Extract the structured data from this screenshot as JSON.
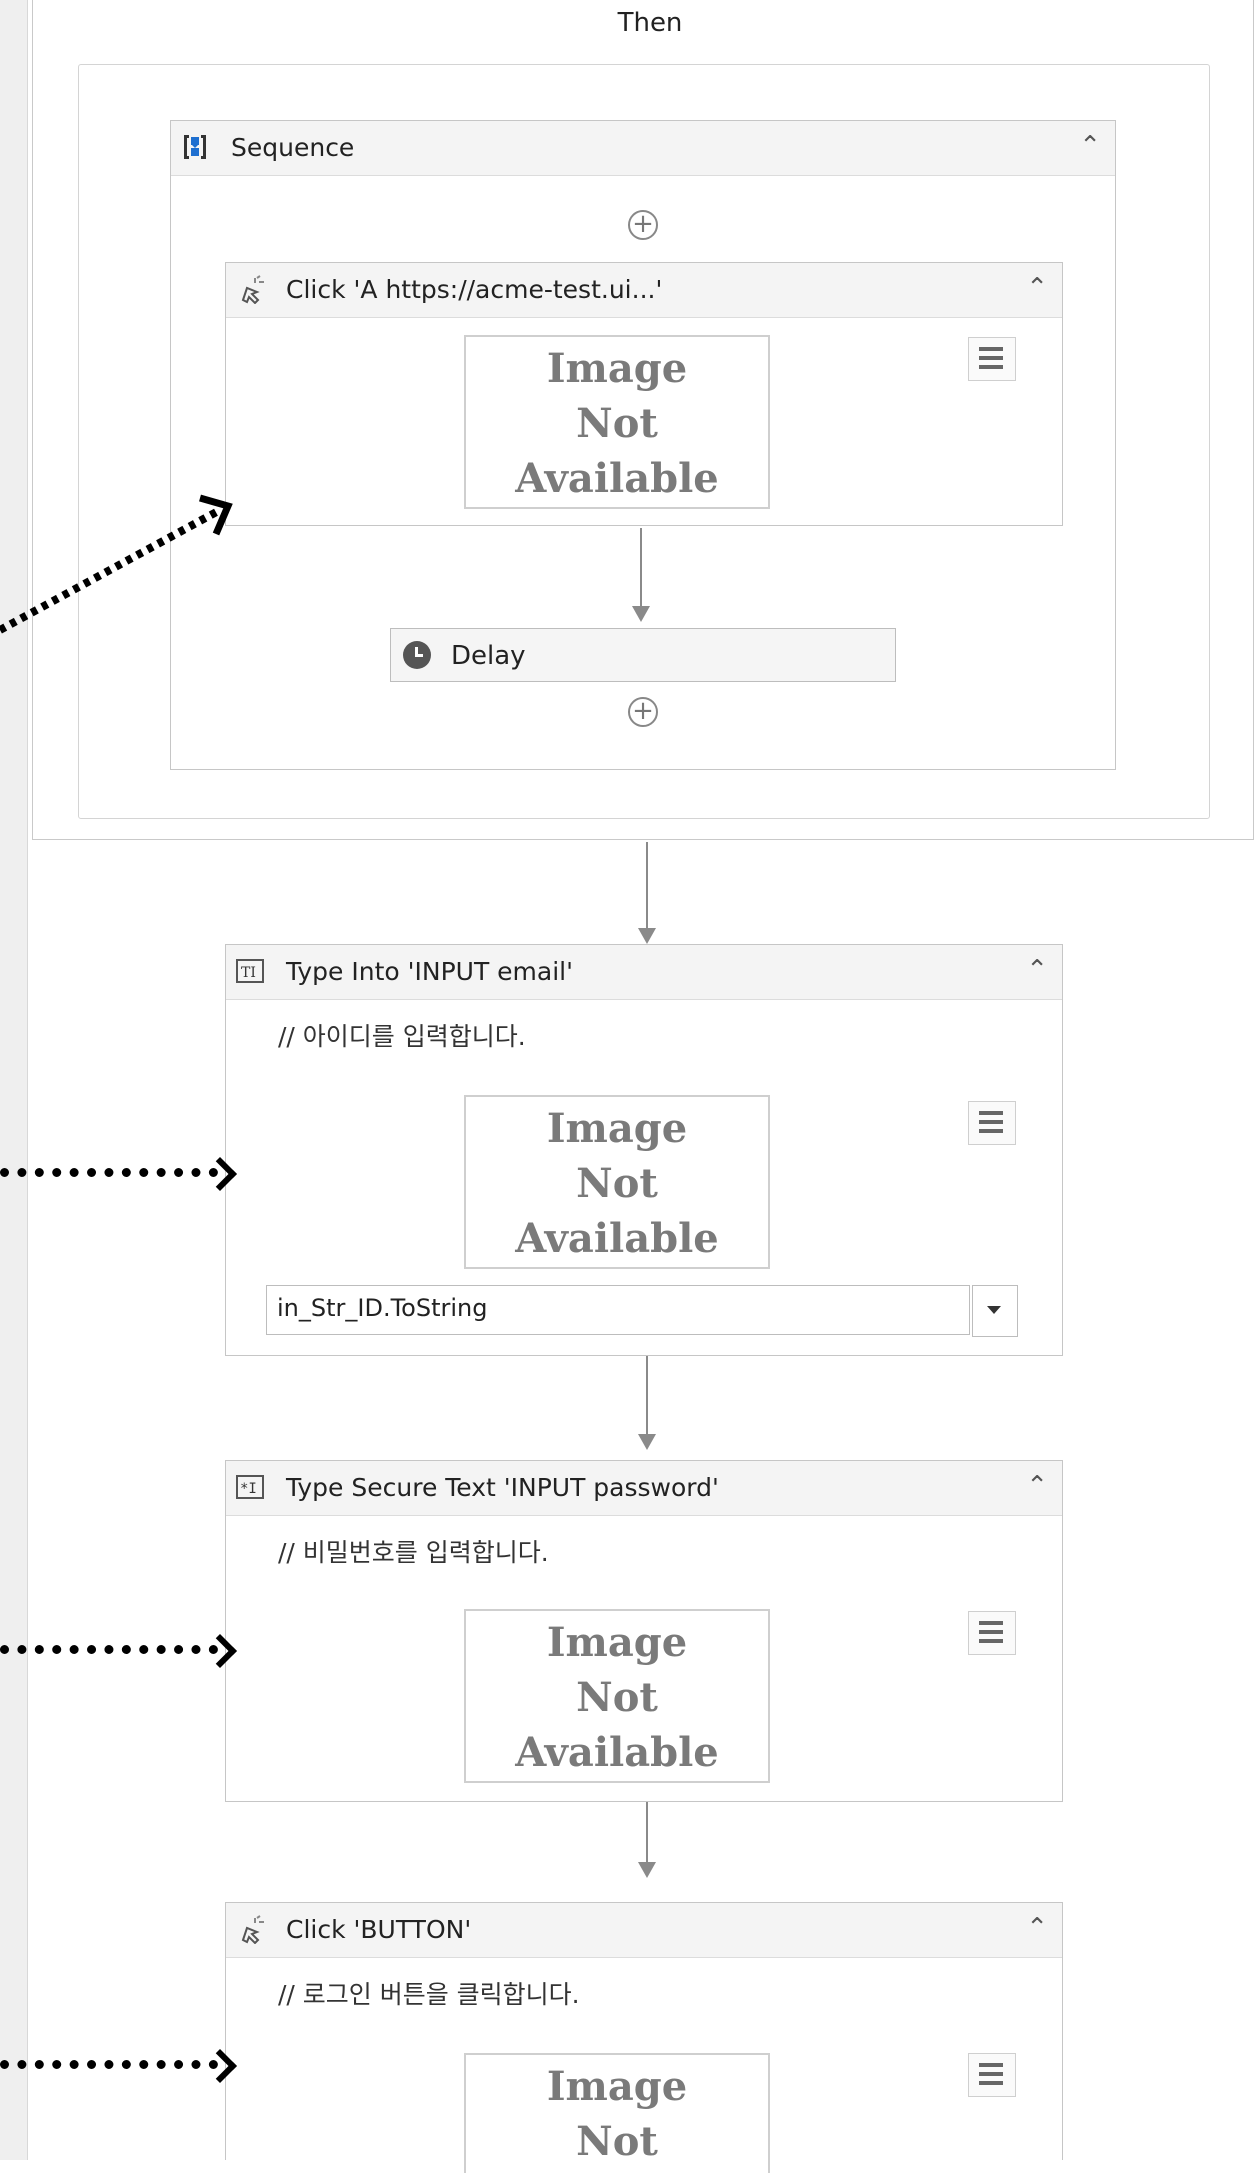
{
  "then_label": "Then",
  "sequence": {
    "title": "Sequence",
    "click_activity": {
      "title": "Click 'A  https://acme-test.ui...'",
      "image_text": [
        "Image",
        "Not",
        "Available"
      ]
    },
    "delay": {
      "label": "Delay"
    }
  },
  "type_into": {
    "title": "Type Into 'INPUT  email'",
    "comment": "// 아이디를 입력합니다.",
    "image_text": [
      "Image",
      "Not",
      "Available"
    ],
    "input_value": "in_Str_ID.ToString"
  },
  "type_secure": {
    "title": "Type Secure Text 'INPUT  password'",
    "comment": "// 비밀번호를 입력합니다.",
    "image_text": [
      "Image",
      "Not",
      "Available"
    ]
  },
  "click_button": {
    "title": "Click 'BUTTON'",
    "comment": "// 로그인 버튼을 클릭합니다.",
    "image_text": [
      "Image",
      "Not"
    ]
  },
  "icons": {
    "sequence": "sequence-icon",
    "click": "click-icon",
    "type_into": "type-into-icon",
    "type_secure": "type-secure-icon",
    "delay": "clock-icon",
    "collapse": "double-chevron-up-icon",
    "menu": "hamburger-menu-icon",
    "add": "plus-circle-icon",
    "dropdown": "dropdown-arrow-icon"
  }
}
